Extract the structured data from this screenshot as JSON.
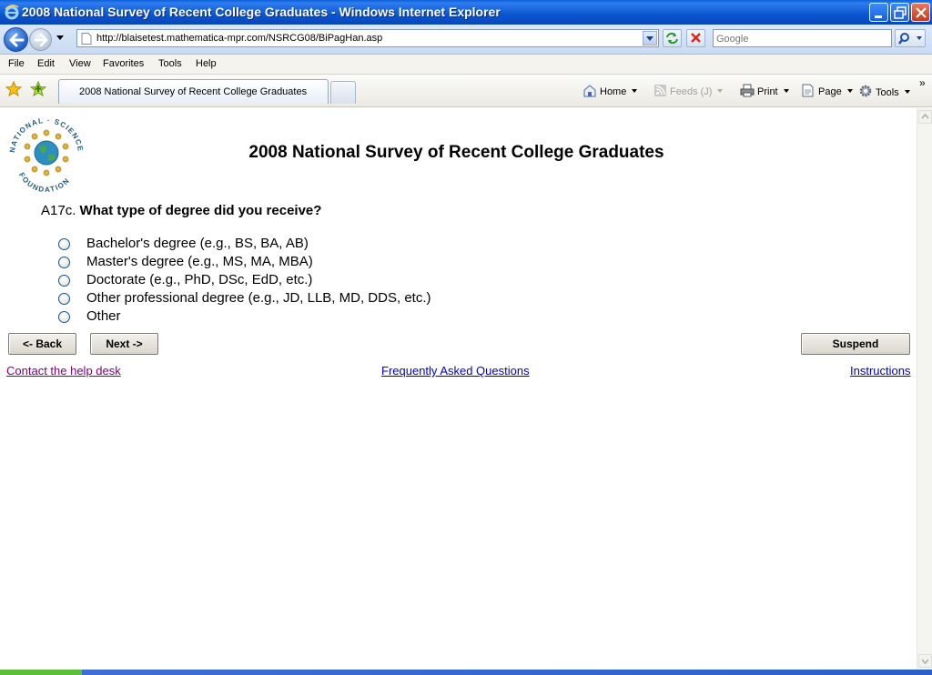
{
  "window": {
    "title": "2008 National Survey of Recent College Graduates - Windows Internet Explorer"
  },
  "address_bar": {
    "url": "http://blaisetest.mathematica-mpr.com/NSRCG08/BiPagHan.asp",
    "search_placeholder": "Google"
  },
  "menu": {
    "items": [
      "File",
      "Edit",
      "View",
      "Favorites",
      "Tools",
      "Help"
    ]
  },
  "tab": {
    "label": "2008 National Survey of Recent College Graduates"
  },
  "command_bar": {
    "home": "Home",
    "feeds": "Feeds (J)",
    "print": "Print",
    "page": "Page",
    "tools": "Tools",
    "overflow": "»"
  },
  "page": {
    "logo_text": "NATIONAL SCIENCE FOUNDATION",
    "title": "2008 National Survey of Recent College Graduates",
    "question_number": "A17c.",
    "question_text": "What type of degree did you receive?",
    "options": [
      "Bachelor's degree (e.g., BS, BA, AB)",
      "Master's degree (e.g., MS, MA, MBA)",
      "Doctorate (e.g., PhD, DSc, EdD, etc.)",
      "Other professional degree (e.g., JD, LLB, MD, DDS, etc.)",
      "Other"
    ],
    "buttons": {
      "back": "<- Back",
      "next": "Next ->",
      "suspend": "Suspend"
    },
    "links": {
      "help_desk": "Contact the help desk",
      "faq": "Frequently Asked Questions",
      "instructions": "Instructions"
    }
  },
  "colors": {
    "title_bar": "#0a56d0",
    "link": "#0000cc",
    "visited_link": "#800080"
  }
}
